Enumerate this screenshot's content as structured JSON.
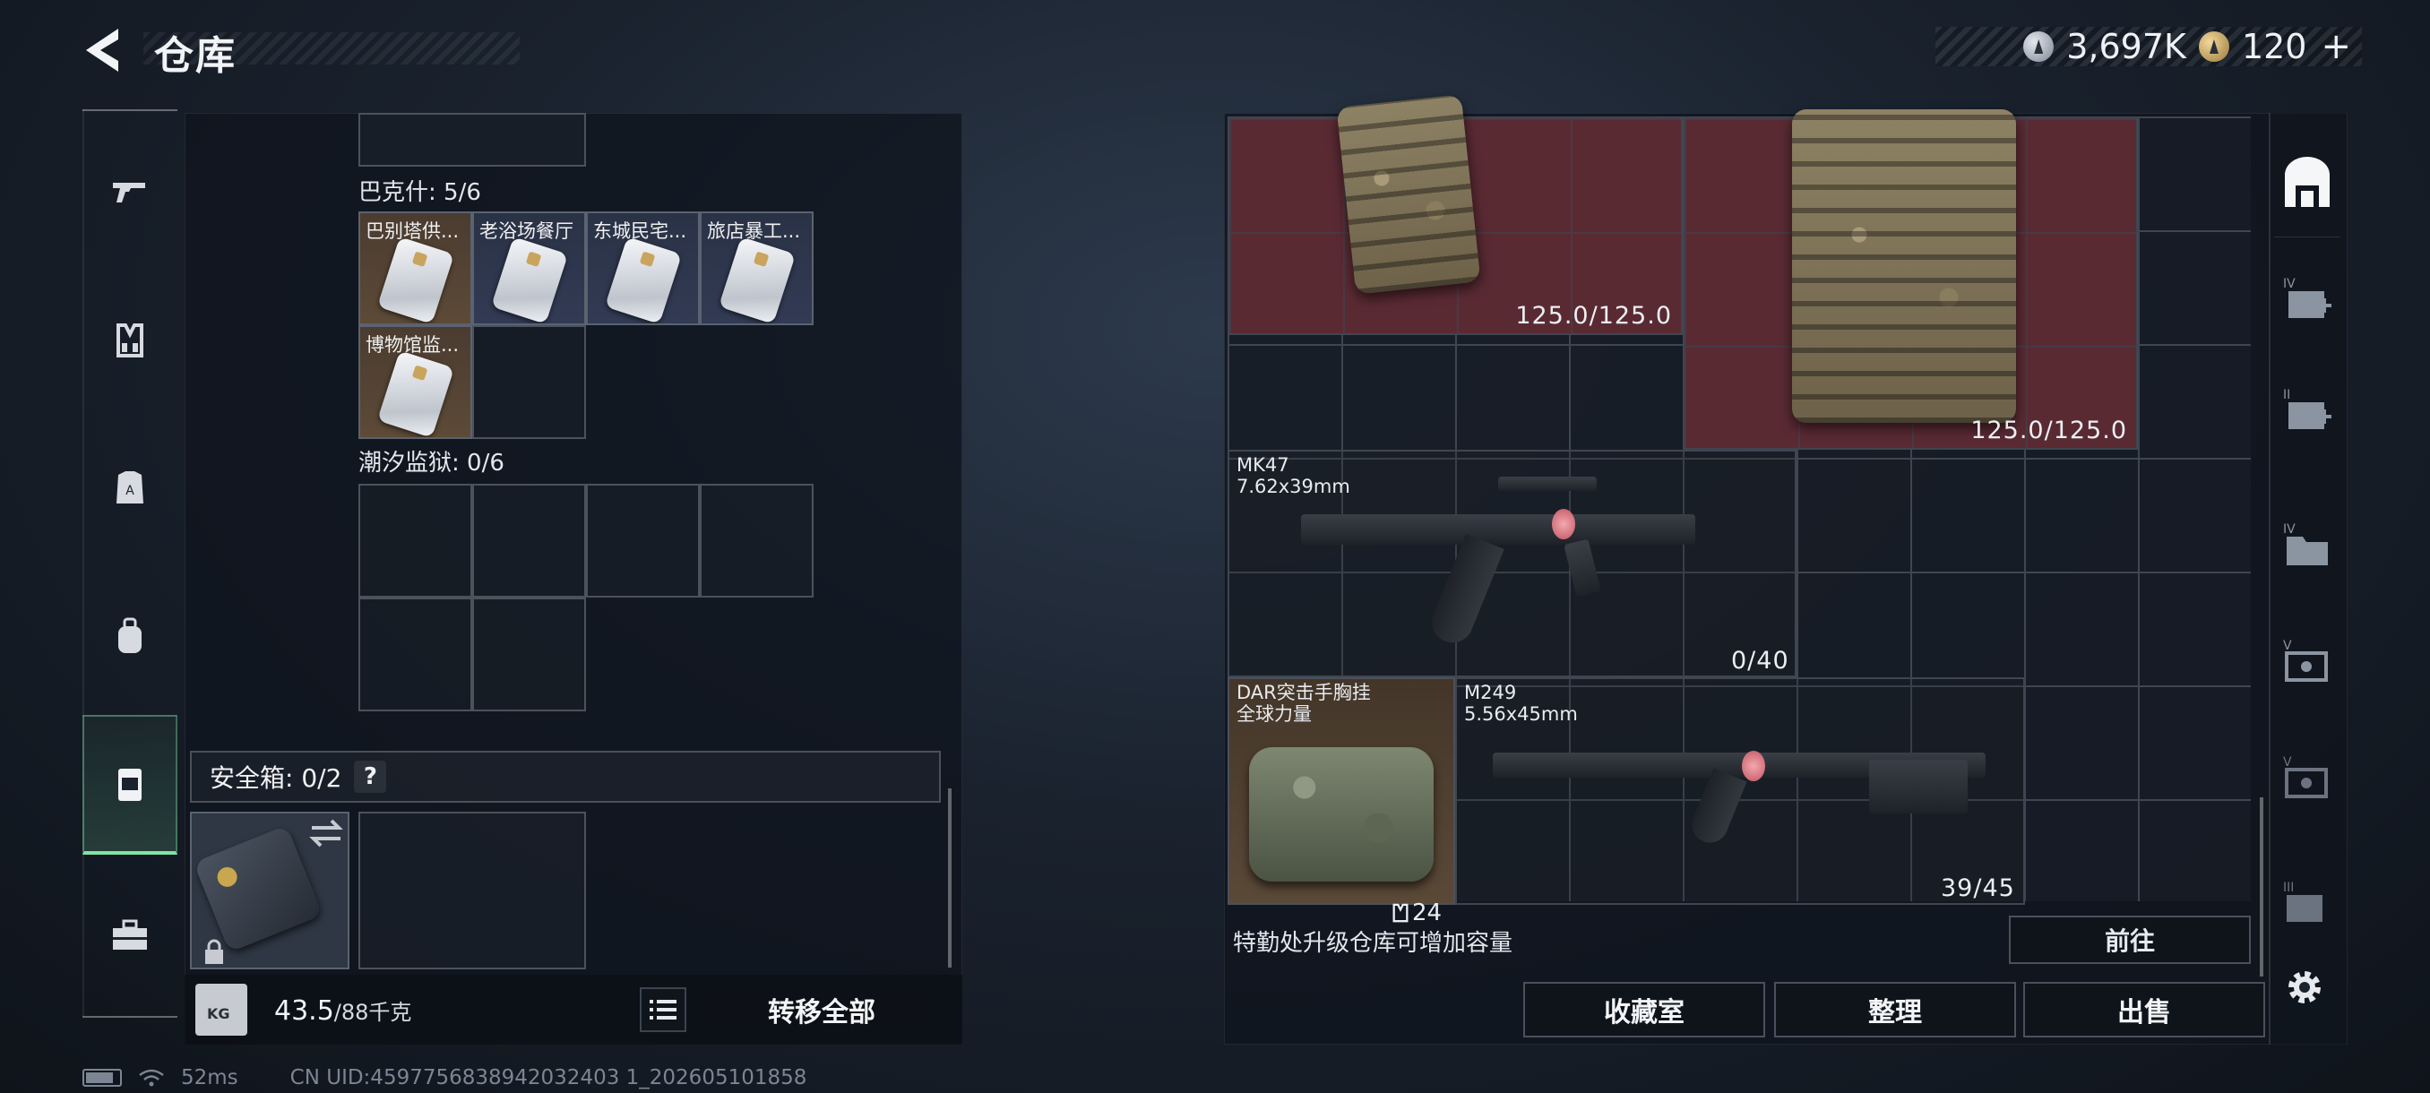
{
  "header": {
    "title": "仓库",
    "currencies": [
      {
        "icon": "silver-coin-icon",
        "value": "3,697K"
      },
      {
        "icon": "gold-coin-icon",
        "value": "120",
        "plus": "+"
      }
    ]
  },
  "left_nav": {
    "items": [
      {
        "name": "weapons",
        "icon": "pistol-icon"
      },
      {
        "name": "vest",
        "icon": "chest-rig-icon"
      },
      {
        "name": "armor",
        "icon": "body-armor-icon"
      },
      {
        "name": "backpack",
        "icon": "backpack-icon"
      },
      {
        "name": "secure-case",
        "icon": "secure-case-icon",
        "active": true
      },
      {
        "name": "toolbox",
        "icon": "toolbox-icon"
      }
    ]
  },
  "left_panel": {
    "sections": [
      {
        "label": "巴克什: 5/6",
        "keys": [
          {
            "name": "巴别塔供...",
            "tint": "brown"
          },
          {
            "name": "老浴场餐厅",
            "tint": "navy"
          },
          {
            "name": "东城民宅...",
            "tint": "navy"
          },
          {
            "name": "旅店暴工...",
            "tint": "navy"
          },
          {
            "name": "博物馆监...",
            "tint": "brown"
          }
        ]
      },
      {
        "label": "潮汐监狱: 0/6",
        "keys": []
      }
    ],
    "safebox": {
      "label": "安全箱: 0/2",
      "help": "?"
    },
    "footer": {
      "weight": "43.5",
      "capacity": "/88千克",
      "transfer_all": "转移全部"
    }
  },
  "right_panel": {
    "items": [
      {
        "kind": "armor",
        "durability": "125.0/125.0"
      },
      {
        "kind": "armor",
        "durability": "125.0/125.0"
      },
      {
        "kind": "weapon",
        "name": "MK47",
        "caliber": "7.62x39mm",
        "ammo": "0/40"
      },
      {
        "kind": "rig",
        "name": "DAR突击手胸挂",
        "subtitle": "全球力量",
        "count": "24"
      },
      {
        "kind": "weapon",
        "name": "M249",
        "caliber": "5.56x45mm",
        "ammo": "39/45"
      }
    ],
    "hint": "特勤处升级仓库可增加容量",
    "goto_label": "前往",
    "buttons": {
      "collection": "收藏室",
      "sort": "整理",
      "sell": "出售"
    }
  },
  "right_tabs": [
    {
      "icon": "warehouse-icon",
      "active": true
    },
    {
      "icon": "tier-iv-medkit-add-icon"
    },
    {
      "icon": "tier-ii-medkit-add-icon"
    },
    {
      "icon": "tier-iv-folder-icon"
    },
    {
      "icon": "tier-v-tool-icon"
    },
    {
      "icon": "tier-v-tool-icon"
    },
    {
      "icon": "tier-iii-gear-icon"
    }
  ],
  "status": {
    "ping": "52ms",
    "uid": "CN UID:4597756838942032403 1_202605101858"
  }
}
